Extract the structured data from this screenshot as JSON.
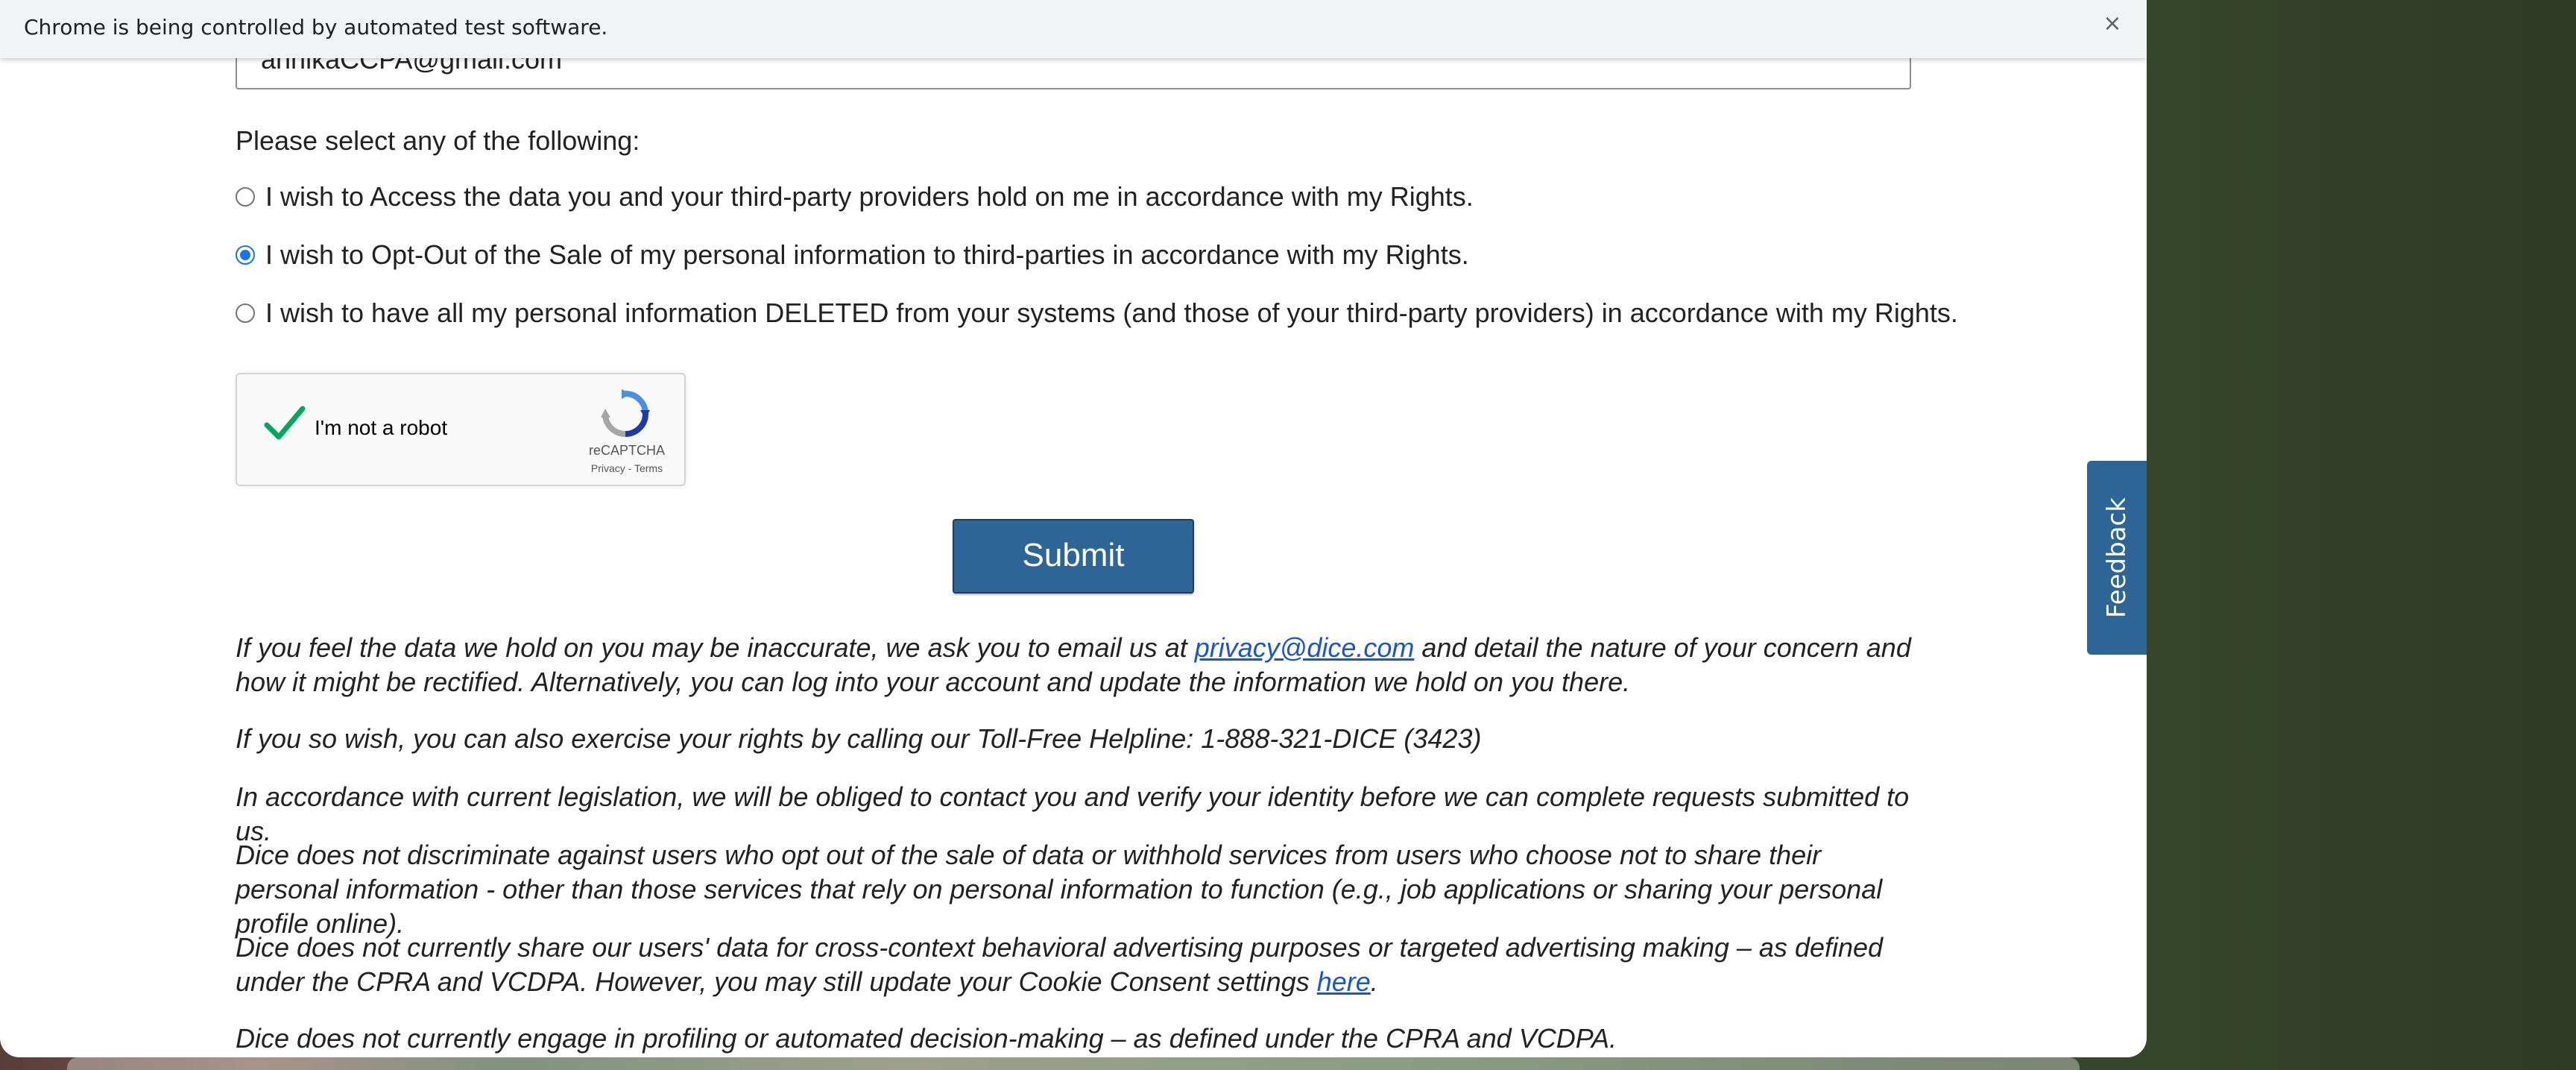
{
  "browser": {
    "infobar_text": "Chrome is being controlled by automated test software.",
    "infobar_close": "×"
  },
  "form": {
    "email_value": "annikaCCPA@gmail.com",
    "select_prompt": "Please select any of the following:",
    "options": [
      {
        "label": "I wish to Access the data you and your third-party providers hold on me in accordance with my Rights.",
        "selected": false
      },
      {
        "label": "I wish to Opt-Out of the Sale of my personal information to third-parties in accordance with my Rights.",
        "selected": true
      },
      {
        "label": "I wish to have all my personal information DELETED from your systems (and those of your third-party providers) in accordance with my Rights.",
        "selected": false
      }
    ],
    "recaptcha": {
      "label": "I'm not a robot",
      "brand": "reCAPTCHA",
      "links": "Privacy - Terms",
      "checked": true
    },
    "submit_label": "Submit"
  },
  "notes": {
    "p1_before": "If you feel the data we hold on you may be inaccurate, we ask you to email us at ",
    "p1_link": "privacy@dice.com",
    "p1_after": " and detail the nature of your concern and how it might be rectified. Alternatively, you can log into your account and update the information we hold on you there.",
    "p2": "If you so wish, you can also exercise your rights by calling our Toll-Free Helpline: 1-888-321-DICE (3423)",
    "p3": "In accordance with current legislation, we will be obliged to contact you and verify your identity before we can complete requests submitted to us.",
    "p4": "Dice does not discriminate against users who opt out of the sale of data or withhold services from users who choose not to share their personal information - other than those services that rely on personal information to function (e.g., job applications or sharing your personal profile online).",
    "p5_before": "Dice does not currently share our users' data for cross-context behavioral advertising purposes or targeted advertising making – as defined under the CPRA and VCDPA. However, you may still update your Cookie Consent settings ",
    "p5_link": "here",
    "p5_after": ".",
    "p6": "Dice does not currently engage in profiling or automated decision-making – as defined under the CPRA and VCDPA."
  },
  "feedback": {
    "label": "Feedback"
  },
  "colors": {
    "accent": "#2c6596",
    "link": "#1a55c9",
    "radio_selected": "#1a73e8",
    "recaptcha_check": "#00a85a"
  }
}
